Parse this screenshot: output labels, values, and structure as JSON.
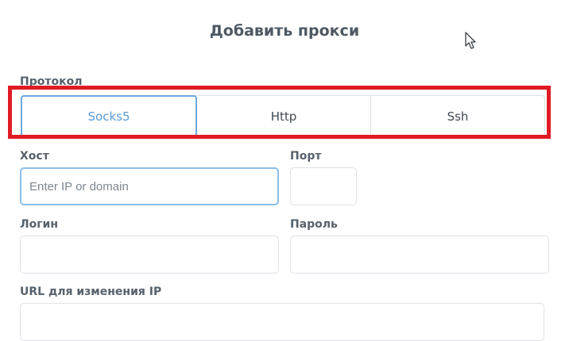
{
  "dialog": {
    "title": "Добавить прокси"
  },
  "protocol": {
    "label": "Протокол",
    "options": [
      "Socks5",
      "Http",
      "Ssh"
    ],
    "selected": "Socks5"
  },
  "host": {
    "label": "Хост",
    "placeholder": "Enter IP or domain",
    "value": ""
  },
  "port": {
    "label": "Порт",
    "value": ""
  },
  "login": {
    "label": "Логин",
    "value": ""
  },
  "password": {
    "label": "Пароль",
    "value": ""
  },
  "change_ip_url": {
    "label": "URL для изменения IP",
    "value": ""
  },
  "colors": {
    "accent": "#5a9bd8",
    "highlight": "#e01b24"
  },
  "icons": {
    "cursor": "mouse-pointer-icon"
  }
}
